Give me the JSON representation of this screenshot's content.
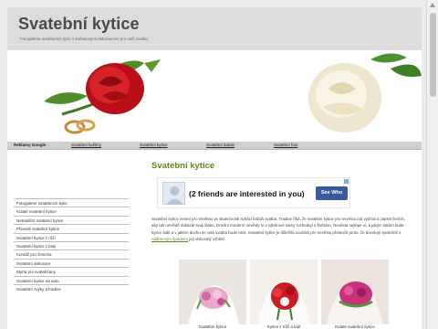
{
  "header": {
    "title": "Svatební kytice",
    "subtitle": "Fotogalerie svatebních kytic s květinovými dekoracemi pro vaši svatbu"
  },
  "nav": {
    "items": [
      "Reklamy Google",
      "Svatební květiny",
      "Svatební kytice",
      "Svatební šatule",
      "Svatební foto"
    ]
  },
  "sidebar": {
    "items": [
      "Fotogalerie svatebních kytic",
      "Kulaté svatební kytice",
      "Netradiční svatební kytice",
      "Převislé svatební kytice",
      "Svatební kytice z růží",
      "Svatební kytice z kaly",
      "Korsáž pro ženicha",
      "Svatební dekorace",
      "Myrta pro svatebčany",
      "Svatební kytice na auto",
      "Svatební zvyky a tradice"
    ]
  },
  "main": {
    "heading": "Svatební kytice",
    "paragraph": "Svatební kytice nesmí pro nevěstu ve skutečnosti schází každá svatba. Tradice říká, že svatební kytice pro nevěstu má vybírat a zajistit ženich, aby tak nevěstě dokázal svoji lásku. Dnešní moderní nevěsty si o výběrové samy rozhodují s floristou. Nevěsta nejlépe ví, k jakým šatům bude kytice ladit a v jakém duchu se celá svatba bude nést. Svatební kytice je důležitá součást pro nevěstu přetančit proto, že dovoluje společně s",
    "paragraph_link": "nádherným šperkem",
    "paragraph_end": "její dokonalý vzhled."
  },
  "ad": {
    "text": "(2 friends are interested in you)",
    "button": "See Who"
  },
  "gallery": {
    "captions": [
      "Svatební kytice",
      "Kytice z růží a kalí",
      "Kulaté svatební kytice"
    ]
  },
  "colors": {
    "header_bg": "#dcdcdc",
    "nav_bg": "#cfcfcf",
    "heading_green": "#5f8a1e",
    "ad_button": "#3b5a9a",
    "red_rose": "#c8141c",
    "white_rose": "#f6f1e2"
  }
}
